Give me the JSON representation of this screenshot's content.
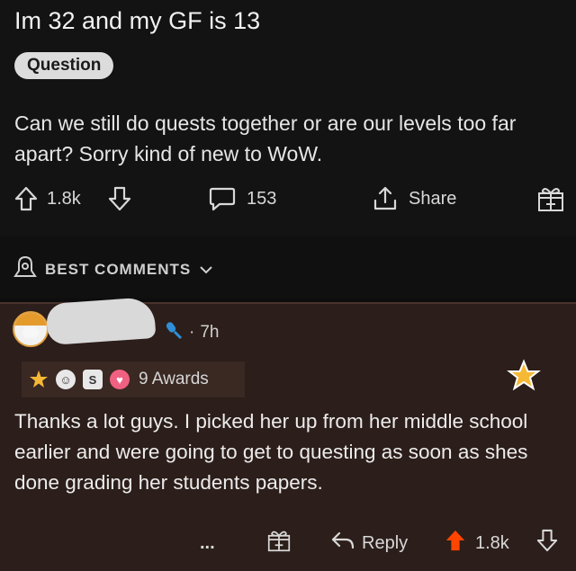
{
  "post": {
    "title": "Im 32 and my GF is 13",
    "flair": "Question",
    "body": "Can we still do quests together or are our levels too far apart? Sorry kind of new to WoW.",
    "upvotes": "1.8k",
    "comments": "153",
    "share_label": "Share"
  },
  "sort": {
    "label": "BEST COMMENTS"
  },
  "comment": {
    "age": "7h",
    "awards_label": "9 Awards",
    "text": "Thanks a lot guys. I picked her up from her middle school earlier and were going to get to questing as soon as shes done grading her students papers.",
    "more": "...",
    "reply_label": "Reply",
    "score": "1.8k"
  },
  "colors": {
    "upvote_active": "#ff4500",
    "comment_bg": "#2c1e1a",
    "award_gold": "#f5b936"
  },
  "icons": [
    "upvote-icon",
    "downvote-icon",
    "comment-bubble-icon",
    "share-icon",
    "gift-award-icon",
    "sort-bell-icon",
    "chevron-down-icon",
    "mic-icon",
    "star-award-icon",
    "reply-arrow-icon"
  ]
}
